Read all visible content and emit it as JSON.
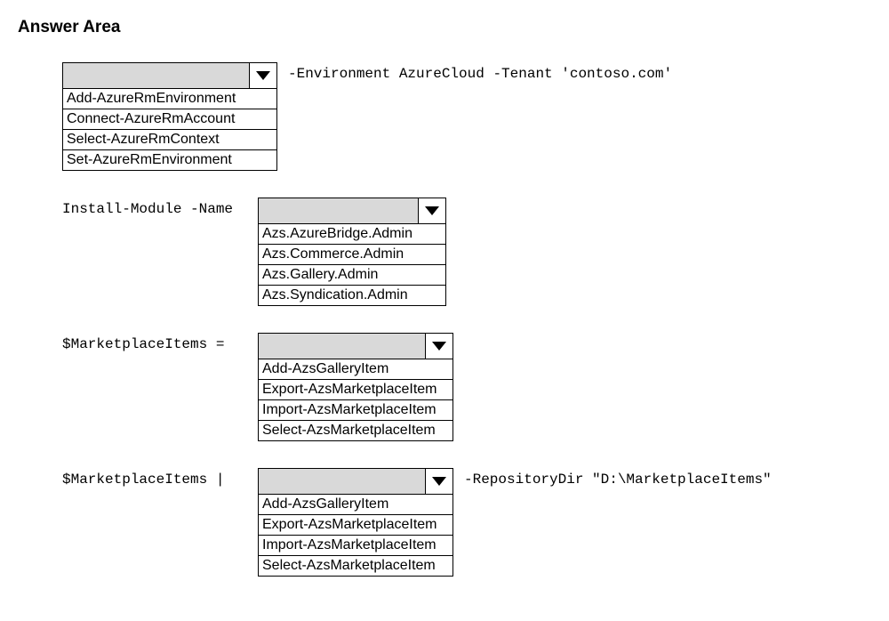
{
  "title": "Answer Area",
  "rows": {
    "r1": {
      "left": "",
      "trail": "-Environment AzureCloud -Tenant 'contoso.com'",
      "options": [
        "Add-AzureRmEnvironment",
        "Connect-AzureRmAccount",
        "Select-AzureRmContext",
        "Set-AzureRmEnvironment"
      ]
    },
    "r2": {
      "left": "Install-Module -Name",
      "trail": "",
      "options": [
        "Azs.AzureBridge.Admin",
        "Azs.Commerce.Admin",
        "Azs.Gallery.Admin",
        "Azs.Syndication.Admin"
      ]
    },
    "r3": {
      "left": "$MarketplaceItems =",
      "trail": "",
      "options": [
        "Add-AzsGalleryItem",
        "Export-AzsMarketplaceItem",
        "Import-AzsMarketplaceItem",
        "Select-AzsMarketplaceItem"
      ]
    },
    "r4": {
      "left": "$MarketplaceItems |",
      "trail": "-RepositoryDir \"D:\\MarketplaceItems\"",
      "options": [
        "Add-AzsGalleryItem",
        "Export-AzsMarketplaceItem",
        "Import-AzsMarketplaceItem",
        "Select-AzsMarketplaceItem"
      ]
    }
  }
}
